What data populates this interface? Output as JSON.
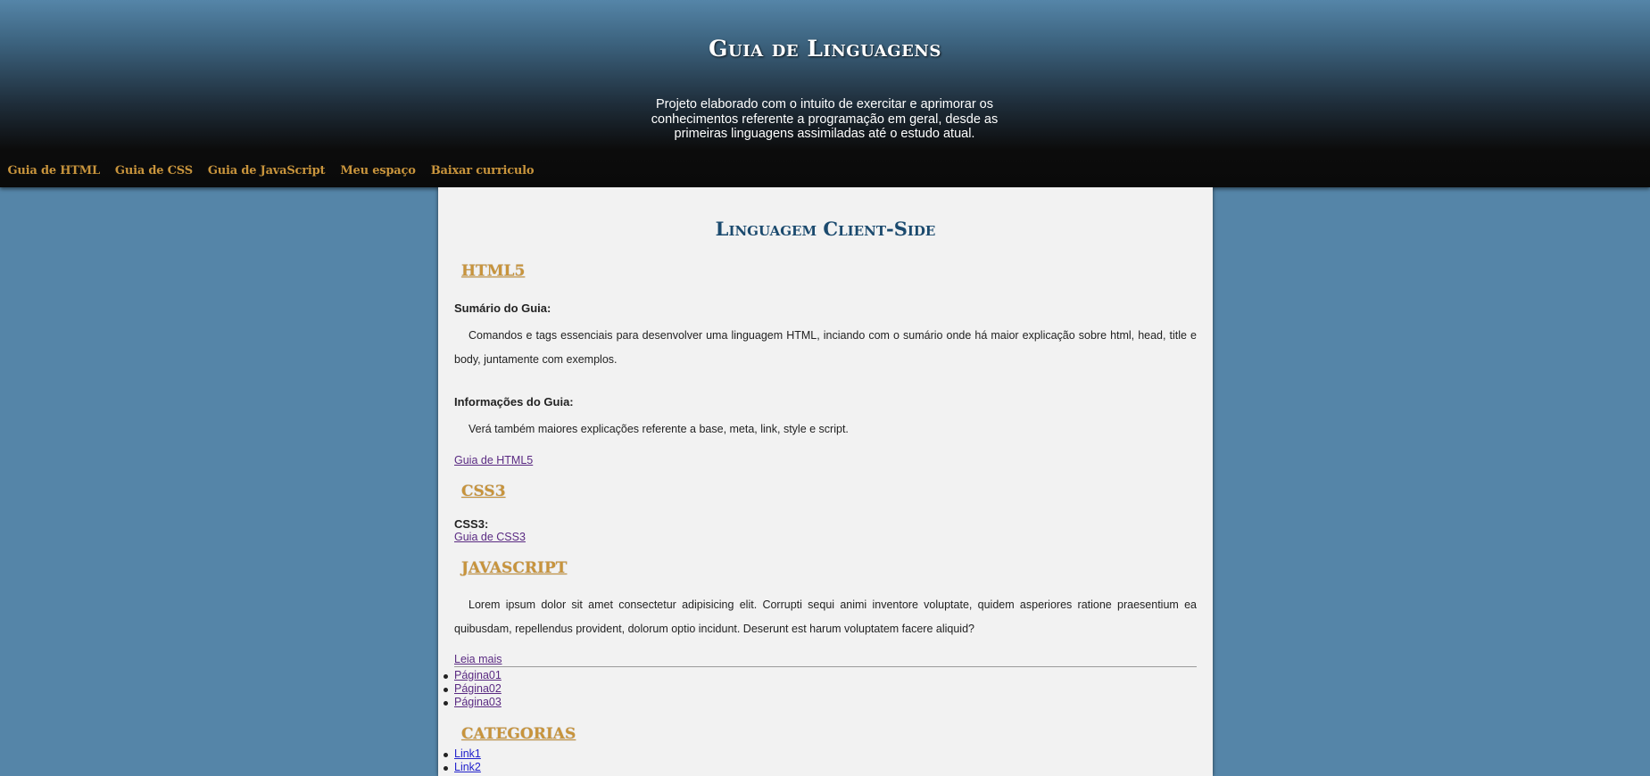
{
  "header": {
    "title": "Guia de Linguagens",
    "description": "Projeto elaborado com o intuito de exercitar e aprimorar os conhecimentos referente a programação em geral, desde as primeiras linguagens assimiladas até o estudo atual."
  },
  "nav": {
    "items": [
      {
        "label": "Guia de HTML"
      },
      {
        "label": "Guia de CSS"
      },
      {
        "label": "Guia de JavaScript"
      },
      {
        "label": "Meu espaço"
      },
      {
        "label": "Baixar curriculo"
      }
    ]
  },
  "main": {
    "title": "Linguagem Client-Side",
    "html5": {
      "title": "HTML5",
      "summary_label": "Sumário do Guia:",
      "summary_text": "Comandos e tags essenciais para desenvolver uma linguagem HTML, inciando com o sumário onde há maior explicação sobre html, head, title e body, juntamente com exemplos.",
      "info_label": "Informações do Guia:",
      "info_text": "Verá também maiores explicações referente a base, meta, link, style e script.",
      "link": "Guia de HTML5"
    },
    "css3": {
      "title": "CSS3",
      "label": "CSS3:",
      "link": "Guia de CSS3"
    },
    "javascript": {
      "title": "JAVASCRIPT",
      "text": "Lorem ipsum dolor sit amet consectetur adipisicing elit. Corrupti sequi animi inventore voluptate, quidem asperiores ratione praesentium ea quibusdam, repellendus provident, dolorum optio incidunt. Deserunt est harum voluptatem facere aliquid?",
      "read_more": "Leia mais",
      "pages": [
        "Página01",
        "Página02",
        "Página03"
      ]
    },
    "categories": {
      "title": "CATEGORIAS",
      "links": [
        "Link1",
        "Link2"
      ]
    }
  },
  "colors": {
    "background": "#5585a8",
    "accent": "#c8943c",
    "title_blue": "#1b4a6e",
    "content_bg": "#f2f2f2"
  }
}
